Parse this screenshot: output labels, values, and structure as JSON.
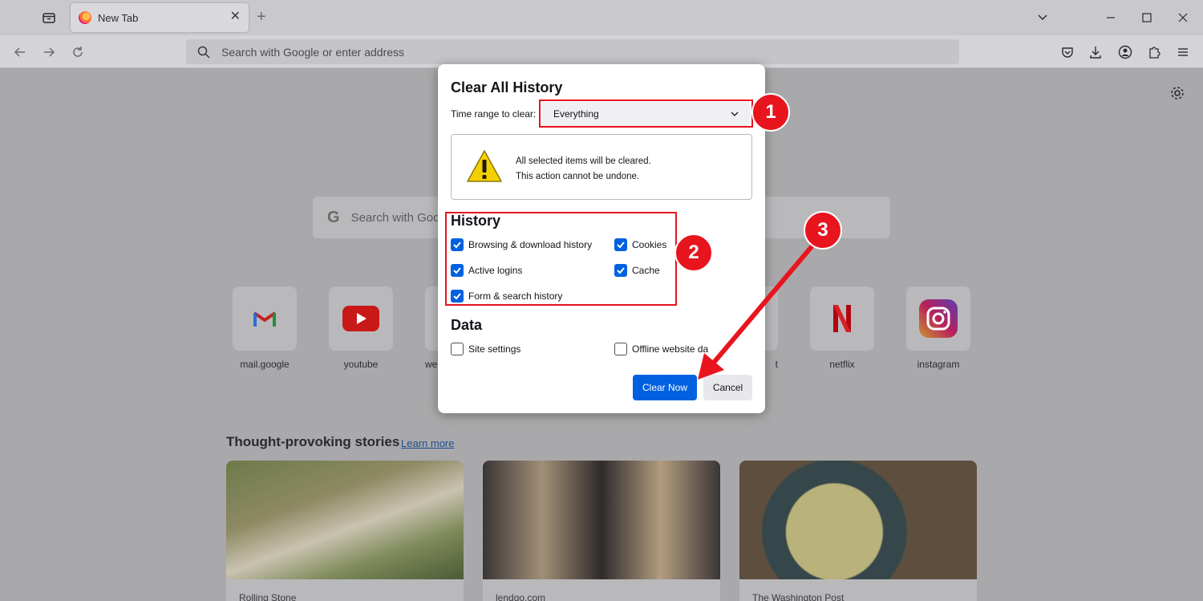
{
  "browser": {
    "tab_title": "New Tab",
    "tab_close_glyph": "✕",
    "new_tab_glyph": "+",
    "url_placeholder": "Search with Google or enter address"
  },
  "newtab": {
    "search_placeholder": "Search with Goo",
    "shortcuts": [
      {
        "label": "mail.google",
        "icon": "gmail-icon"
      },
      {
        "label": "youtube",
        "icon": "youtube-icon"
      },
      {
        "label": "we",
        "icon": "generic-icon"
      },
      {
        "label": "t",
        "icon": "generic-icon"
      },
      {
        "label": "netflix",
        "icon": "netflix-icon"
      },
      {
        "label": "instagram",
        "icon": "instagram-icon"
      }
    ],
    "stories_title": "Thought-provoking stories",
    "learn_more": "Learn more",
    "stories": [
      {
        "source": "Rolling Stone"
      },
      {
        "source": "lendgo.com"
      },
      {
        "source": "The Washington Post"
      }
    ]
  },
  "dialog": {
    "title": "Clear All History",
    "time_range_label": "Time range to clear:",
    "time_range_value": "Everything",
    "warning_line1": "All selected items will be cleared.",
    "warning_line2": "This action cannot be undone.",
    "history_heading": "History",
    "history_items": [
      {
        "label": "Browsing & download history",
        "checked": true
      },
      {
        "label": "Cookies",
        "checked": true
      },
      {
        "label": "Active logins",
        "checked": true
      },
      {
        "label": "Cache",
        "checked": true
      },
      {
        "label": "Form & search history",
        "checked": true
      }
    ],
    "data_heading": "Data",
    "data_items": [
      {
        "label": "Site settings",
        "checked": false
      },
      {
        "label": "Offline website da",
        "checked": false
      }
    ],
    "clear_button": "Clear Now",
    "cancel_button": "Cancel"
  },
  "annotations": {
    "badge1": "1",
    "badge2": "2",
    "badge3": "3",
    "color": "#e8141e"
  },
  "colors": {
    "accent": "#0061e0"
  }
}
